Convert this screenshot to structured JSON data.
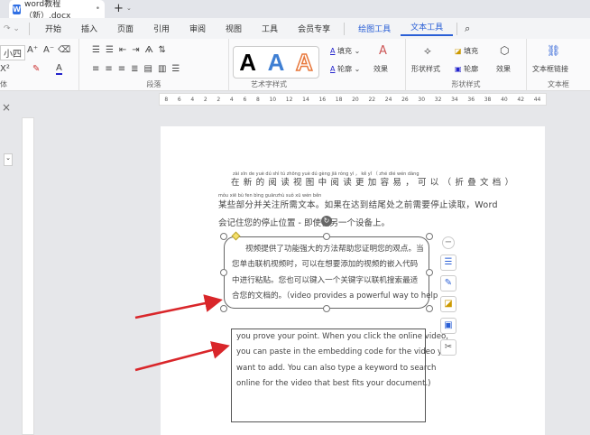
{
  "tabbar": {
    "doc_title": "word教程（新）.docx",
    "add": "+"
  },
  "menu": [
    "开始",
    "插入",
    "页面",
    "引用",
    "审阅",
    "视图",
    "工具",
    "会员专享",
    "绘图工具",
    "文本工具"
  ],
  "ribbon": {
    "font_size": "小四",
    "groups": {
      "paragraph": "段落",
      "art": "艺术字样式",
      "shape": "形状样式",
      "textbox": "文本框",
      "font": "体"
    },
    "fill": "填充",
    "outline": "轮廓",
    "effect": "效果",
    "shape_style": "形状样式",
    "textbox_link": "文本框链接"
  },
  "ruler_ticks": [
    "8",
    "6",
    "4",
    "2",
    "",
    "2",
    "4",
    "6",
    "8",
    "10",
    "12",
    "14",
    "16",
    "18",
    "20",
    "22",
    "24",
    "26",
    "",
    "30",
    "32",
    "34",
    "36",
    "38",
    "40",
    "42",
    "44"
  ],
  "doc": {
    "pinyin1": "zài xīn de yuè dú shì tú zhōng yuè dú gèng jiā róng yì ， kě yǐ （ zhé dié wén dàng",
    "line1": "在新的阅读视图中阅读更加容易，可以（折叠文档）",
    "pinyin2": "mǒu xiē bù fen bìng guānzhù suǒ xū wén běn",
    "line2": "某些部分并关注所需文本。如果在达到结尾处之前需要停止读取，Word",
    "line3": "会记住您的停止位置 - 即使在另一个设备上。",
    "box1": [
      "视频提供了功能强大的方法帮助您证明您的观点。当",
      "您单击联机视频时，可以在想要添加的视频的嵌入代码",
      "中进行粘贴。您也可以键入一个关键字以联机搜索最适",
      "合您的文档的。（video provides a powerful way to help"
    ],
    "box2": [
      "you prove your point. When you click the online video,",
      "you can paste in the embedding code for the video you",
      "want to add. You can also type a keyword to search",
      "online for the video that best fits your document.)"
    ]
  },
  "colors": {
    "accent": "#2a5fd6",
    "arrow": "#d9262a"
  }
}
